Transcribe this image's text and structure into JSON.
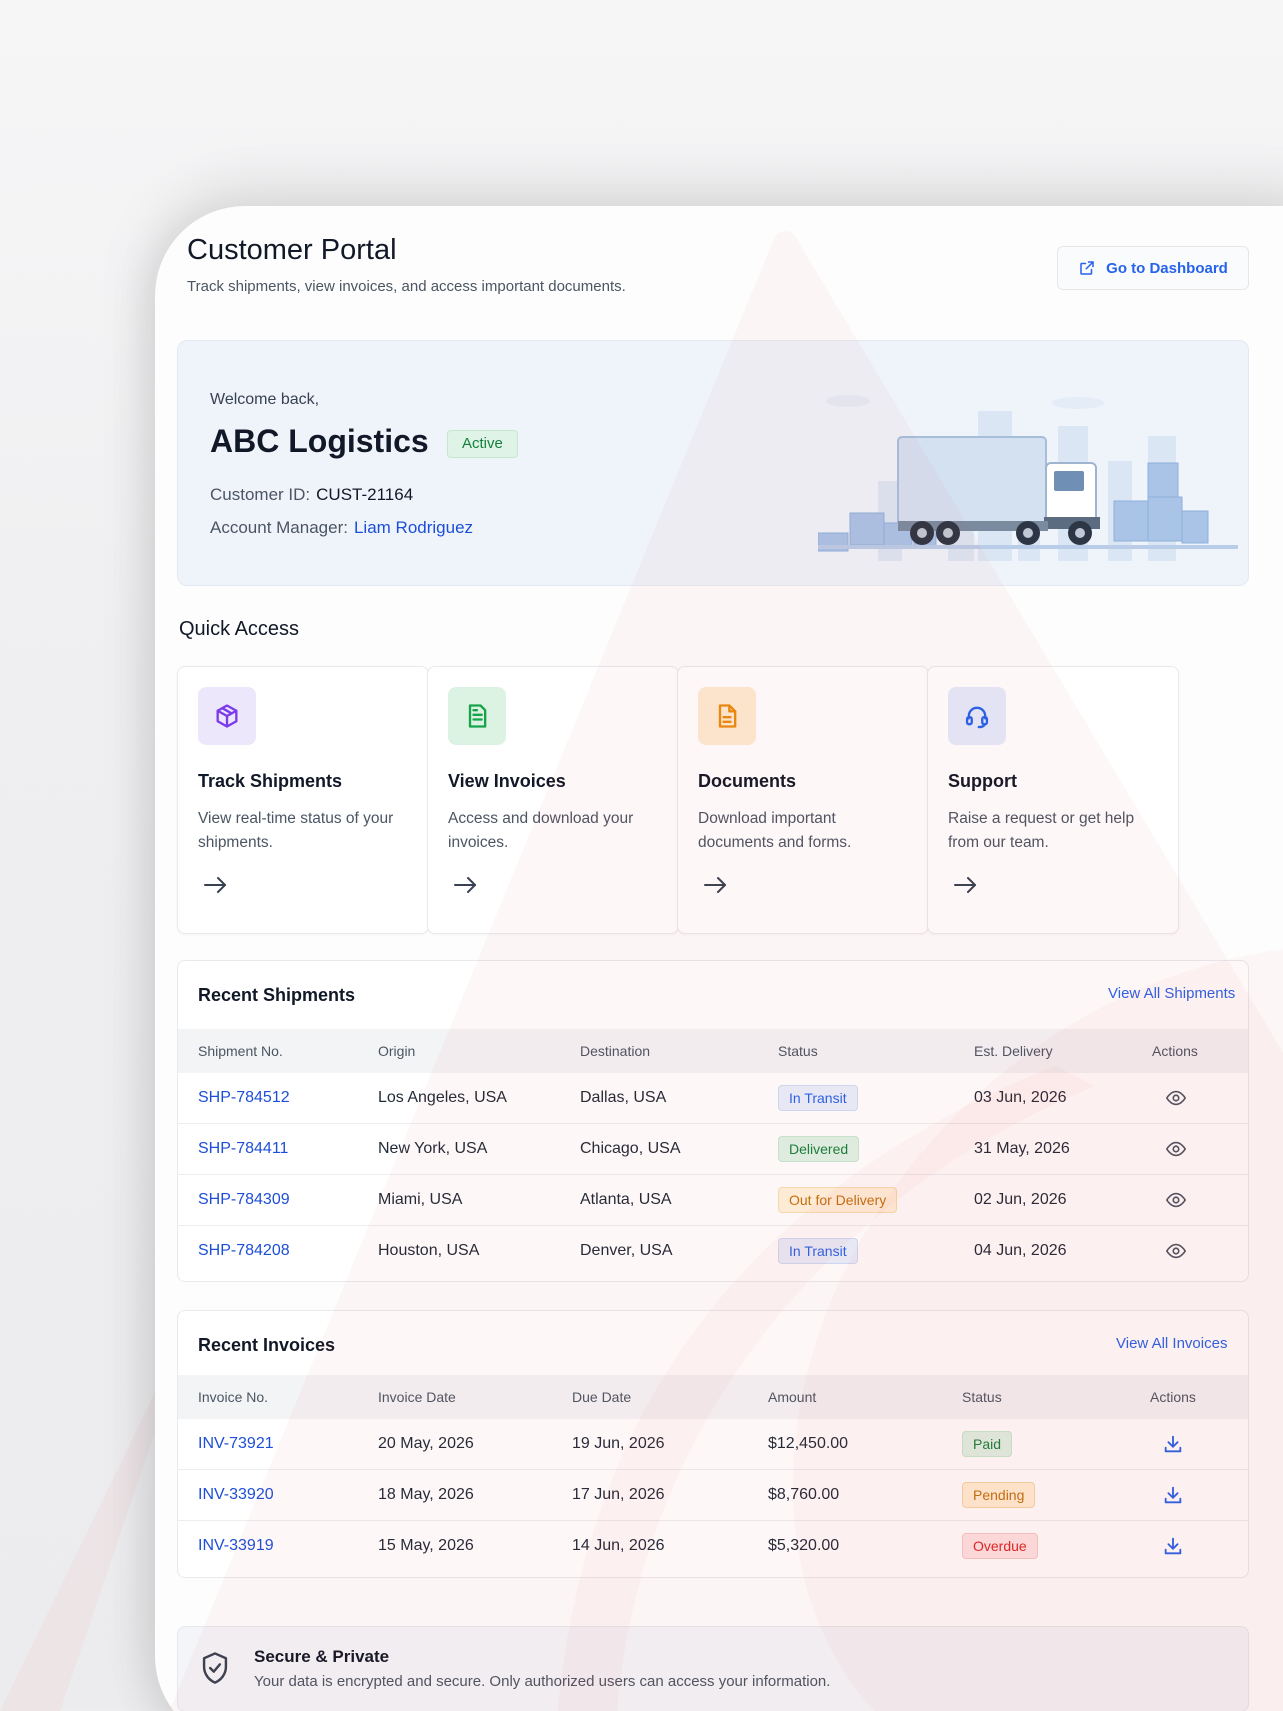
{
  "header": {
    "title": "Customer Portal",
    "subtitle": "Track shipments, view invoices, and access important documents.",
    "dashboard_button": "Go to Dashboard"
  },
  "welcome": {
    "greeting": "Welcome back,",
    "company": "ABC Logistics",
    "status": "Active",
    "customer_id_label": "Customer ID:",
    "customer_id": "CUST-21164",
    "manager_label": "Account Manager:",
    "manager": "Liam Rodriguez"
  },
  "quick_access": {
    "title": "Quick Access",
    "cards": [
      {
        "title": "Track Shipments",
        "desc": "View real-time status of your shipments.",
        "icon": "box-icon",
        "color": "#7c3aed",
        "bg": "#ede7fb"
      },
      {
        "title": "View Invoices",
        "desc": "Access and download your invoices.",
        "icon": "invoice-icon",
        "color": "#16a34a",
        "bg": "#dcf3e4"
      },
      {
        "title": "Documents",
        "desc": "Download important documents and forms.",
        "icon": "document-icon",
        "color": "#ea8a0c",
        "bg": "#fdecd3"
      },
      {
        "title": "Support",
        "desc": "Raise a request or get help from our team.",
        "icon": "headset-icon",
        "color": "#2563eb",
        "bg": "#e3ebfb"
      }
    ]
  },
  "shipments": {
    "title": "Recent Shipments",
    "view_all": "View All Shipments",
    "columns": [
      "Shipment No.",
      "Origin",
      "Destination",
      "Status",
      "Est. Delivery",
      "Actions"
    ],
    "rows": [
      {
        "id": "SHP-784512",
        "origin": "Los Angeles, USA",
        "destination": "Dallas, USA",
        "status": "In Transit",
        "eta": "03 Jun, 2026"
      },
      {
        "id": "SHP-784411",
        "origin": "New York, USA",
        "destination": "Chicago, USA",
        "status": "Delivered",
        "eta": "31 May, 2026"
      },
      {
        "id": "SHP-784309",
        "origin": "Miami, USA",
        "destination": "Atlanta, USA",
        "status": "Out for Delivery",
        "eta": "02 Jun, 2026"
      },
      {
        "id": "SHP-784208",
        "origin": "Houston, USA",
        "destination": "Denver, USA",
        "status": "In Transit",
        "eta": "04 Jun, 2026"
      }
    ]
  },
  "invoices": {
    "title": "Recent Invoices",
    "view_all": "View All Invoices",
    "columns": [
      "Invoice No.",
      "Invoice Date",
      "Due Date",
      "Amount",
      "Status",
      "Actions"
    ],
    "rows": [
      {
        "id": "INV-73921",
        "date": "20 May, 2026",
        "due": "19 Jun, 2026",
        "amount": "$12,450.00",
        "status": "Paid"
      },
      {
        "id": "INV-33920",
        "date": "18 May, 2026",
        "due": "17 Jun, 2026",
        "amount": "$8,760.00",
        "status": "Pending"
      },
      {
        "id": "INV-33919",
        "date": "15 May, 2026",
        "due": "14 Jun, 2026",
        "amount": "$5,320.00",
        "status": "Overdue"
      }
    ]
  },
  "secure": {
    "title": "Secure & Private",
    "text": "Your data is encrypted and secure. Only authorized users can access your information."
  }
}
